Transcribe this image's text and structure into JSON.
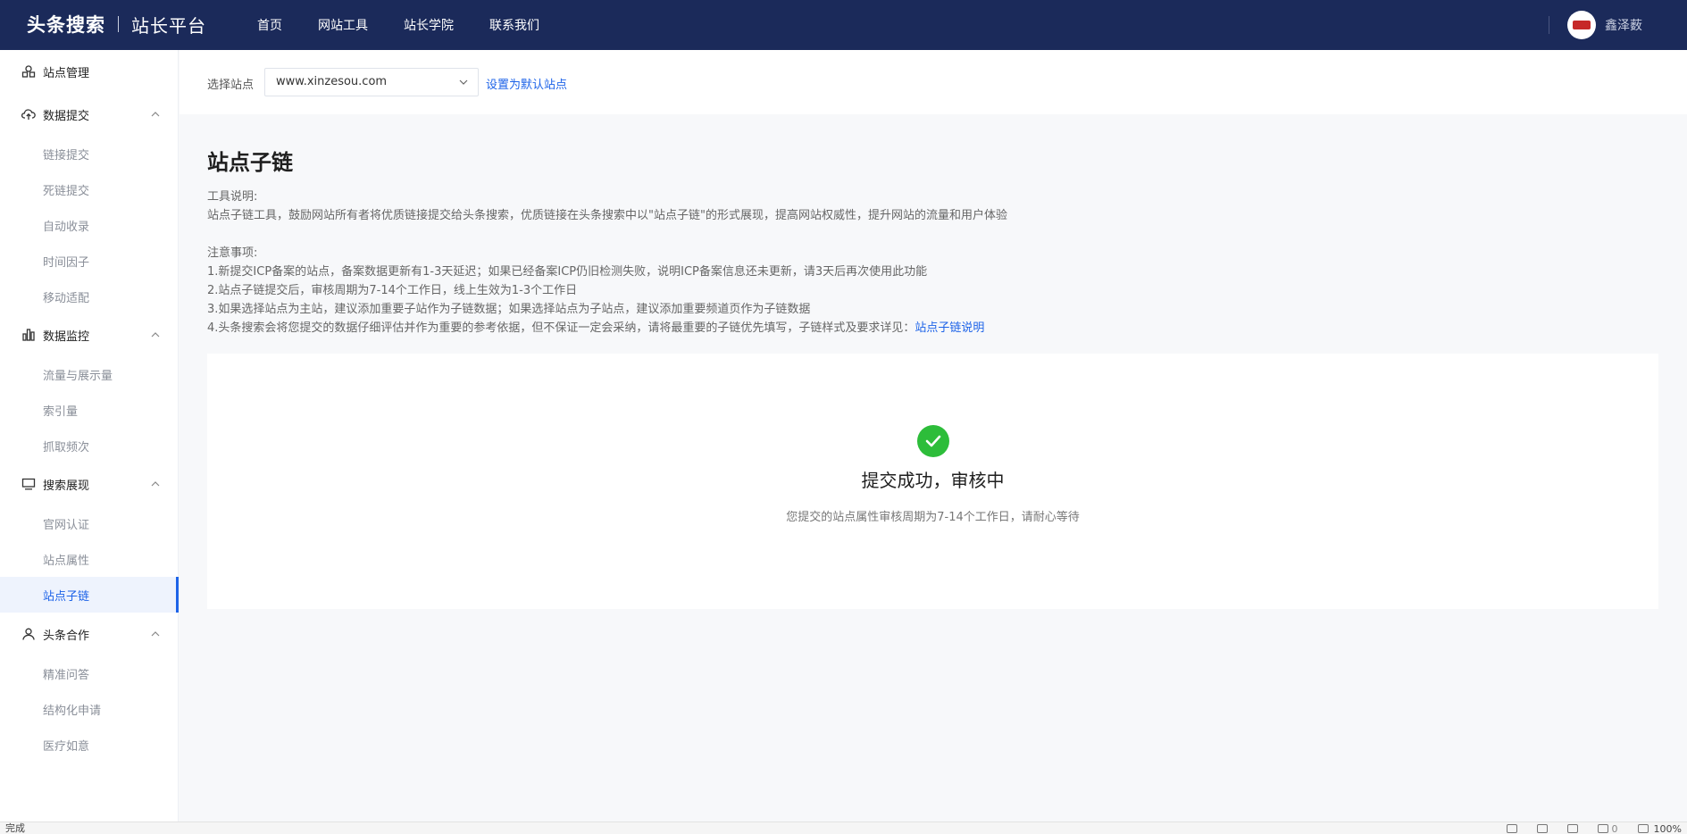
{
  "topbar": {
    "brand_main": "头条搜索",
    "brand_sub": "站长平台",
    "nav": [
      "首页",
      "网站工具",
      "站长学院",
      "联系我们"
    ],
    "user_name": "鑫泽薮"
  },
  "sidebar": {
    "site_manage": "站点管理",
    "groups": [
      {
        "label": "数据提交",
        "items": [
          "链接提交",
          "死链提交",
          "自动收录",
          "时间因子",
          "移动适配"
        ]
      },
      {
        "label": "数据监控",
        "items": [
          "流量与展示量",
          "索引量",
          "抓取频次"
        ]
      },
      {
        "label": "搜索展现",
        "items": [
          "官网认证",
          "站点属性",
          "站点子链"
        ]
      },
      {
        "label": "头条合作",
        "items": [
          "精准问答",
          "结构化申请",
          "医疗如意"
        ]
      }
    ],
    "active_item": "站点子链"
  },
  "sitebar": {
    "label": "选择站点",
    "selected_site": "www.xinzesou.com",
    "set_default": "设置为默认站点"
  },
  "main": {
    "title": "站点子链",
    "tool_desc_heading": "工具说明:",
    "tool_desc": "站点子链工具，鼓励网站所有者将优质链接提交给头条搜索，优质链接在头条搜索中以\"站点子链\"的形式展现，提高网站权威性，提升网站的流量和用户体验",
    "notes_heading": "注意事项:",
    "notes": [
      "1.新提交ICP备案的站点，备案数据更新有1-3天延迟；如果已经备案ICP仍旧检测失败，说明ICP备案信息还未更新，请3天后再次使用此功能",
      "2.站点子链提交后，审核周期为7-14个工作日，线上生效为1-3个工作日",
      "3.如果选择站点为主站，建议添加重要子站作为子链数据；如果选择站点为子站点，建议添加重要频道页作为子链数据"
    ],
    "note4_prefix": "4.头条搜索会将您提交的数据仔细评估并作为重要的参考依据，但不保证一定会采纳，请将最重要的子链优先填写，子链样式及要求详见：",
    "note4_link": "站点子链说明",
    "result_title": "提交成功，审核中",
    "result_sub": "您提交的站点属性审核周期为7-14个工作日，请耐心等待"
  },
  "statusbar": {
    "status": "完成",
    "count": "0",
    "zoom": "100%"
  },
  "colors": {
    "topbar": "#1b2a5a",
    "accent": "#1d63e8",
    "success": "#2dbd3a"
  }
}
